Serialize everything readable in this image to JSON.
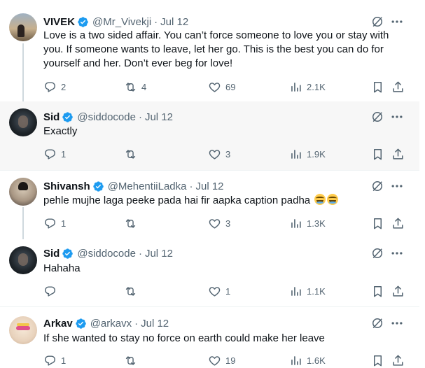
{
  "tweets": [
    {
      "name": "VIVEK",
      "handle": "@Mr_Vivekji",
      "time": "Jul 12",
      "text": "Love is a two sided affair. You can’t force someone to love you or stay with you. If someone wants to leave, let her go. This is the best you can do for yourself and her. Don’t ever beg for love!",
      "replies": "2",
      "reposts": "4",
      "likes": "69",
      "views": "2.1K"
    },
    {
      "name": "Sid",
      "handle": "@siddocode",
      "time": "Jul 12",
      "text": "Exactly",
      "replies": "1",
      "reposts": "",
      "likes": "3",
      "views": "1.9K"
    },
    {
      "name": "Shivansh",
      "handle": "@MehentiiLadka",
      "time": "Jul 12",
      "text": "pehle mujhe laga peeke pada hai fir aapka caption padha",
      "emoji": "😂😂",
      "replies": "1",
      "reposts": "",
      "likes": "3",
      "views": "1.3K"
    },
    {
      "name": "Sid",
      "handle": "@siddocode",
      "time": "Jul 12",
      "text": "Hahaha",
      "replies": "",
      "reposts": "",
      "likes": "1",
      "views": "1.1K"
    },
    {
      "name": "Arkav",
      "handle": "@arkavx",
      "time": "Jul 12",
      "text": "If she wanted to stay no force on earth could make her leave",
      "replies": "1",
      "reposts": "",
      "likes": "19",
      "views": "1.6K"
    }
  ],
  "icons": {
    "verified": "verified-badge-icon",
    "grok": "grok-icon",
    "more": "more-icon",
    "reply": "reply-icon",
    "repost": "repost-icon",
    "like": "like-icon",
    "views": "views-icon",
    "bookmark": "bookmark-icon",
    "share": "share-icon"
  },
  "colors": {
    "verified": "#1d9bf0",
    "secondary_text": "#536471",
    "shaded_bg": "#f7f7f7"
  }
}
